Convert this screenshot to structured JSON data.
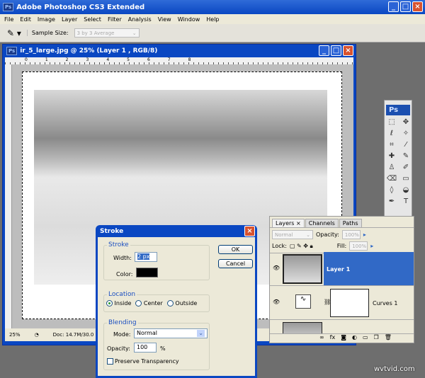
{
  "app": {
    "title": "Adobe Photoshop CS3 Extended",
    "ps_badge": "Ps"
  },
  "menu": [
    "File",
    "Edit",
    "Image",
    "Layer",
    "Select",
    "Filter",
    "Analysis",
    "View",
    "Window",
    "Help"
  ],
  "options": {
    "sample_size_label": "Sample Size:",
    "sample_size_value": "3 by 3 Average"
  },
  "document": {
    "title": "ir_5_large.jpg @ 25% (Layer 1 , RGB/8)",
    "ruler_ticks": [
      "0",
      "1",
      "2",
      "3",
      "4",
      "5",
      "6",
      "7",
      "8"
    ],
    "zoom": "25%",
    "doc_info": "Doc: 14.7M/30.0"
  },
  "stroke_dialog": {
    "title": "Stroke",
    "stroke_group": "Stroke",
    "width_label": "Width:",
    "width_value": "2 px",
    "color_label": "Color:",
    "stroke_color": "#000000",
    "location_group": "Location",
    "location_options": [
      "Inside",
      "Center",
      "Outside"
    ],
    "location_selected": "Inside",
    "blending_group": "Blending",
    "mode_label": "Mode:",
    "mode_value": "Normal",
    "opacity_label": "Opacity:",
    "opacity_value": "100",
    "opacity_unit": "%",
    "preserve_label": "Preserve Transparency",
    "preserve_checked": false,
    "ok": "OK",
    "cancel": "Cancel"
  },
  "layers_panel": {
    "tabs": [
      "Layers",
      "Channels",
      "Paths"
    ],
    "blend_mode": "Normal",
    "opacity_label": "Opacity:",
    "opacity_value": "100%",
    "lock_label": "Lock:",
    "fill_label": "Fill:",
    "fill_value": "100%",
    "layers": [
      {
        "name": "Layer 1",
        "selected": true
      },
      {
        "name": "Curves 1",
        "selected": false
      },
      {
        "name": "",
        "selected": false
      }
    ],
    "selection_color": "#3169c6"
  },
  "tools_panel": {
    "badge": "Ps"
  },
  "watermark": "wvtvid.com"
}
